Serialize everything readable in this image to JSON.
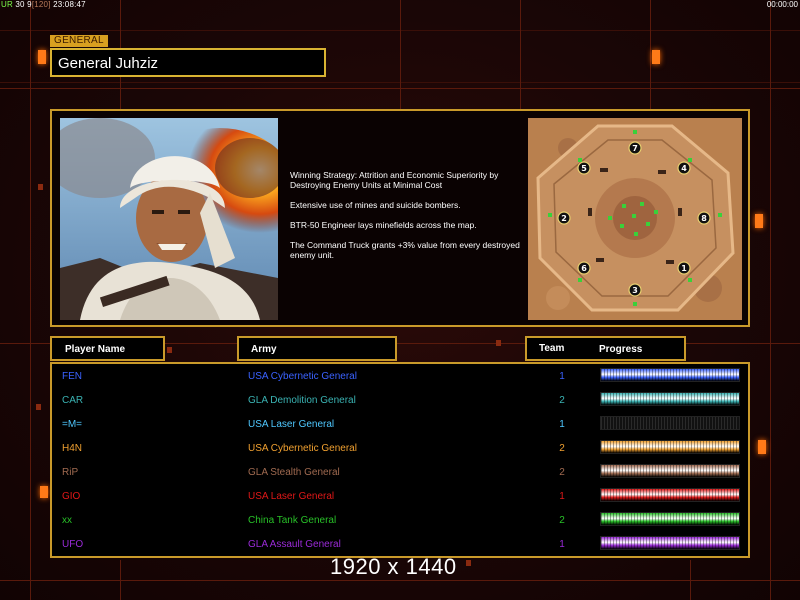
{
  "status": {
    "fps_label": "UR",
    "fps": "30",
    "frame": "9",
    "frame_total": "120",
    "time": "23:08:47",
    "clock": "00:00:00"
  },
  "general": {
    "tag": "GENERAL",
    "name": "General Juhziz"
  },
  "strategy": [
    "Winning Strategy: Attrition and Economic Superiority by Destroying Enemy Units at Minimal Cost",
    "Extensive use of mines and suicide bombers.",
    "BTR-50 Engineer lays minefields across the map.",
    "The Command Truck grants +3% value from every destroyed enemy unit."
  ],
  "headers": {
    "player_name": "Player Name",
    "army": "Army",
    "team": "Team",
    "progress": "Progress"
  },
  "players": [
    {
      "name": "FEN",
      "army": "USA Cybernetic General",
      "team": "1",
      "color": "#3a62ff",
      "progress": 1.0
    },
    {
      "name": "CAR",
      "army": "GLA Demolition General",
      "team": "2",
      "color": "#3ab3b3",
      "progress": 1.0
    },
    {
      "name": "=M=",
      "army": "USA Laser General",
      "team": "1",
      "color": "#4fc8ff",
      "progress": 0.0
    },
    {
      "name": "H4N",
      "army": "USA Cybernetic General",
      "team": "2",
      "color": "#f0a030",
      "progress": 1.0
    },
    {
      "name": "RiP",
      "army": "GLA Stealth General",
      "team": "2",
      "color": "#a06a50",
      "progress": 1.0
    },
    {
      "name": "GIO",
      "army": "USA Laser General",
      "team": "1",
      "color": "#e01818",
      "progress": 1.0
    },
    {
      "name": "xx",
      "army": "China Tank General",
      "team": "2",
      "color": "#28c028",
      "progress": 1.0
    },
    {
      "name": "UFO",
      "army": "GLA Assault General",
      "team": "1",
      "color": "#9a2ad8",
      "progress": 1.0
    }
  ],
  "map_slots": [
    "7",
    "5",
    "4",
    "2",
    "8",
    "6",
    "1",
    "3"
  ],
  "resolution": "1920 x 1440"
}
